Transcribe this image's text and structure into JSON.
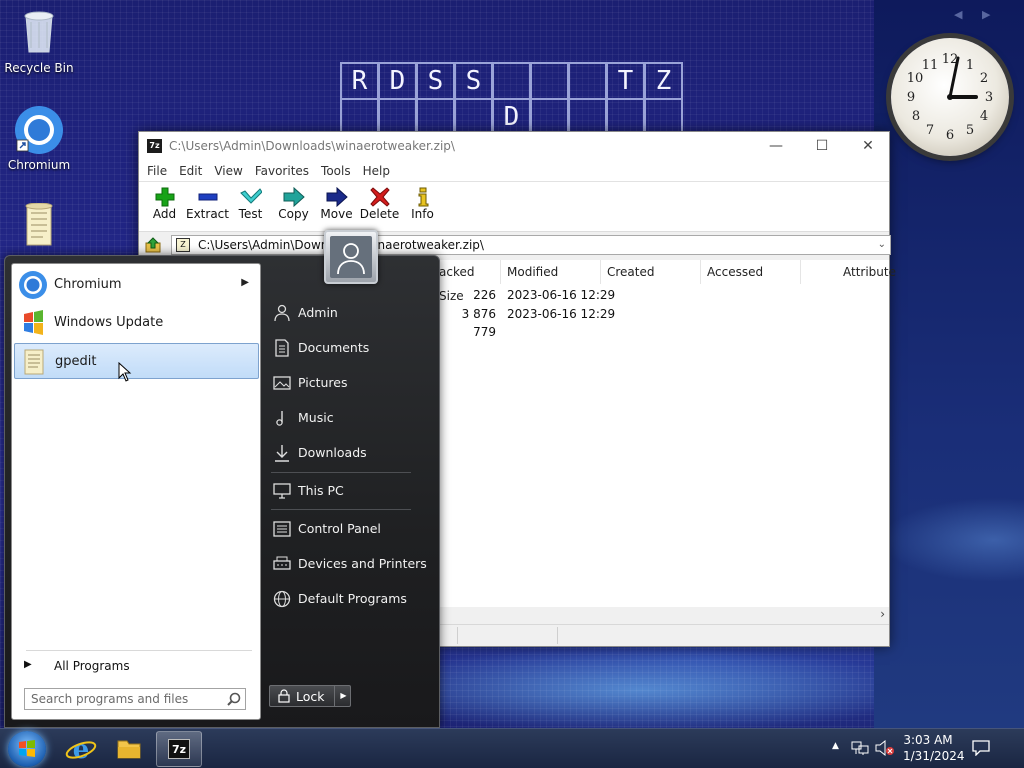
{
  "desktop": {
    "icons": [
      {
        "label": "Recycle Bin",
        "icon": "recycle-bin-icon"
      },
      {
        "label": "Chromium",
        "icon": "chromium-icon"
      },
      {
        "label": "",
        "icon": "document-icon"
      }
    ],
    "crossword": {
      "row1": [
        "R",
        "D",
        "S",
        "S",
        "",
        "",
        "",
        "T",
        "Z"
      ],
      "row2": [
        "",
        "",
        "",
        "",
        "D",
        "",
        "",
        "",
        ""
      ]
    },
    "clock": {
      "hours": [
        "12",
        "1",
        "2",
        "3",
        "4",
        "5",
        "6",
        "7",
        "8",
        "9",
        "10",
        "11"
      ],
      "time": "3:03"
    }
  },
  "window": {
    "title": "C:\\Users\\Admin\\Downloads\\winaerotweaker.zip\\",
    "app_icon_text": "7z",
    "menu": [
      "File",
      "Edit",
      "View",
      "Favorites",
      "Tools",
      "Help"
    ],
    "toolbar": [
      "Add",
      "Extract",
      "Test",
      "Copy",
      "Move",
      "Delete",
      "Info"
    ],
    "address": "C:\\Users\\Admin\\Downloads\\winaerotweaker.zip\\",
    "columns": [
      "acked Size",
      "Modified",
      "Created",
      "Accessed",
      "Attribute"
    ],
    "rows": [
      {
        "packed": "226",
        "modified": "2023-06-16 12:29"
      },
      {
        "packed": "3 876 779",
        "modified": "2023-06-16 12:29"
      }
    ]
  },
  "startmenu": {
    "programs": [
      {
        "label": "Chromium",
        "icon": "chromium-icon",
        "submenu": true
      },
      {
        "label": "Windows Update",
        "icon": "windows-update-icon",
        "submenu": false
      },
      {
        "label": "gpedit",
        "icon": "gpedit-icon",
        "submenu": false,
        "selected": true
      }
    ],
    "all_programs": "All Programs",
    "search_placeholder": "Search programs and files",
    "right_items": [
      {
        "label": "Admin",
        "icon": "user-folder-icon"
      },
      {
        "label": "Documents",
        "icon": "documents-icon"
      },
      {
        "label": "Pictures",
        "icon": "pictures-icon"
      },
      {
        "label": "Music",
        "icon": "music-icon"
      },
      {
        "label": "Downloads",
        "icon": "downloads-icon"
      },
      {
        "label": "This PC",
        "icon": "computer-icon"
      },
      {
        "label": "Control Panel",
        "icon": "control-panel-icon"
      },
      {
        "label": "Devices and Printers",
        "icon": "printer-icon"
      },
      {
        "label": "Default Programs",
        "icon": "globe-icon"
      }
    ],
    "lock_label": "Lock"
  },
  "taskbar": {
    "pinned": [
      "internet-explorer-icon",
      "file-explorer-icon",
      "7zip-icon"
    ],
    "time": "3:03 AM",
    "date": "1/31/2024"
  },
  "colors": {
    "desktop_bg": "#24288c",
    "selection": "#c1dcf8",
    "add_green": "#18a318",
    "delete_red": "#d21c1c"
  }
}
